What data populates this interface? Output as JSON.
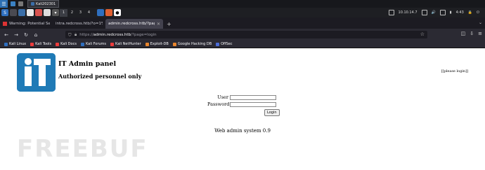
{
  "panel": {
    "window_title": "Kali202301"
  },
  "workspaces": [
    "1",
    "2",
    "3",
    "4"
  ],
  "tray": {
    "ip": "10.10.14.7",
    "clock": "4:43"
  },
  "tabs": [
    {
      "label": "Warning: Potential Secu"
    },
    {
      "label": "intra.redcross.htb/?o=1%27A"
    },
    {
      "label": "admin.redcross.htb/?page=lo"
    }
  ],
  "urlbar": {
    "scheme": "https://",
    "host": "admin.redcross.htb",
    "path": "/?page=login"
  },
  "bookmarks": [
    {
      "label": "Kali Linux",
      "color": "#2f6fbf"
    },
    {
      "label": "Kali Tools",
      "color": "#ec3c3c"
    },
    {
      "label": "Kali Docs",
      "color": "#ec3c3c"
    },
    {
      "label": "Kali Forums",
      "color": "#2f6fbf"
    },
    {
      "label": "Kali NetHunter",
      "color": "#ec3c3c"
    },
    {
      "label": "Exploit-DB",
      "color": "#e8862d"
    },
    {
      "label": "Google Hacking DB",
      "color": "#e8862d"
    },
    {
      "label": "OffSec",
      "color": "#4b6bd6"
    }
  ],
  "page": {
    "logo_text": "IT",
    "title": "IT Admin panel",
    "subtitle": "Authorized personnel only",
    "please_login": "[[please login]]",
    "user_label": "User",
    "password_label": "Password",
    "login_button": "Login",
    "footer": "Web admin system 0.9",
    "watermark": "FREEBUF"
  },
  "colors": {
    "logo_blue": "#1f7ab6",
    "panel_bg": "#17181c",
    "tab_active": "#42414d"
  }
}
